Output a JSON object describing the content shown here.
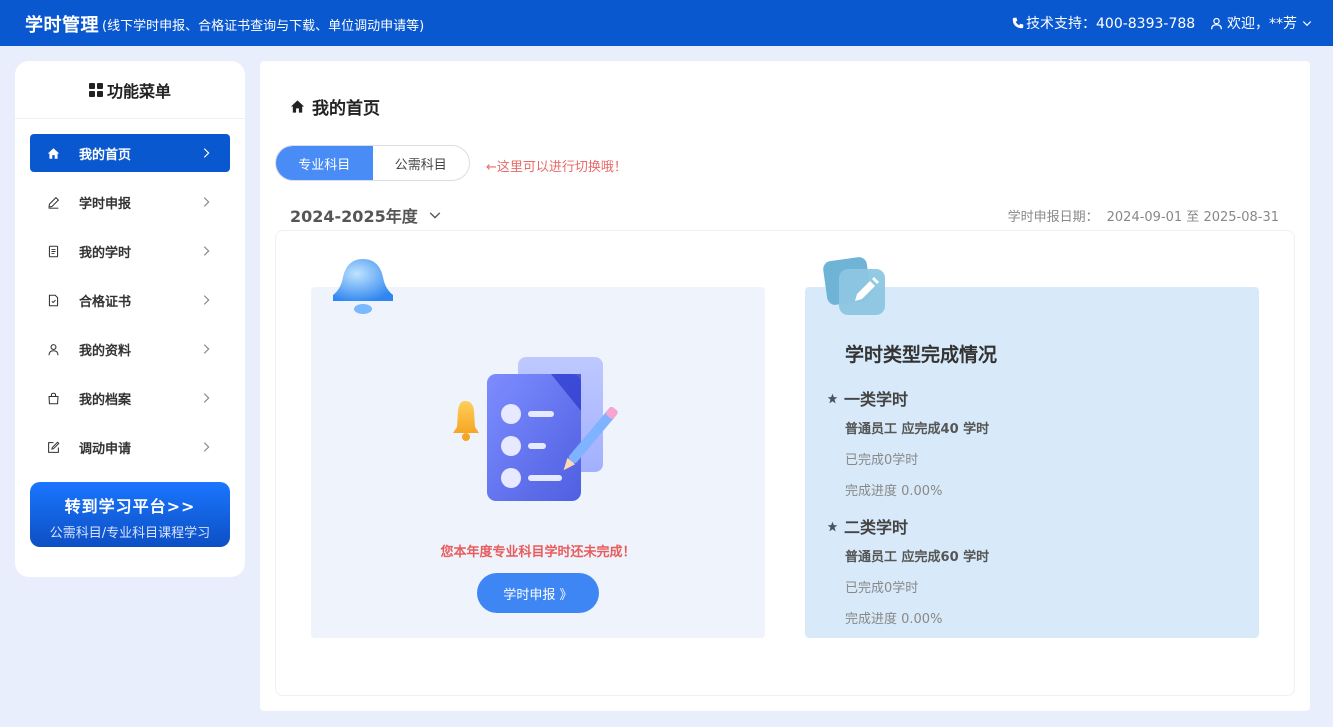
{
  "header": {
    "brand": "学时管理",
    "subtitle": "(线下学时申报、合格证书查询与下载、单位调动申请等)",
    "support_label": "技术支持：400-8393-788",
    "user_label": "欢迎，**芳"
  },
  "sidebar": {
    "title": "功能菜单",
    "items": [
      {
        "label": "我的首页",
        "icon": "home-icon",
        "active": true
      },
      {
        "label": "学时申报",
        "icon": "pen-icon",
        "active": false
      },
      {
        "label": "我的学时",
        "icon": "document-icon",
        "active": false
      },
      {
        "label": "合格证书",
        "icon": "certificate-icon",
        "active": false
      },
      {
        "label": "我的资料",
        "icon": "user-icon",
        "active": false
      },
      {
        "label": "我的档案",
        "icon": "bag-icon",
        "active": false
      },
      {
        "label": "调动申请",
        "icon": "edit-icon",
        "active": false
      }
    ],
    "platform_button": {
      "title": "转到学习平台>>",
      "subtitle": "公需科目/专业科目课程学习"
    }
  },
  "main": {
    "page_title": "我的首页",
    "tabs": [
      {
        "label": "专业科目",
        "active": true
      },
      {
        "label": "公需科目",
        "active": false
      }
    ],
    "tab_hint": "←这里可以进行切换哦！",
    "year_select": "2024-2025年度",
    "date_label": "学时申报日期：",
    "date_value": "2024-09-01 至 2025-08-31",
    "left_card": {
      "warning": "您本年度专业科目学时还未完成！",
      "button": "学时申报 》"
    },
    "right_card": {
      "title": "学时类型完成情况",
      "sections": [
        {
          "name": "一类学时",
          "requirement": "普通员工 应完成40 学时",
          "completed": "已完成0学时",
          "progress": "完成进度 0.00%"
        },
        {
          "name": "二类学时",
          "requirement": "普通员工 应完成60 学时",
          "completed": "已完成0学时",
          "progress": "完成进度 0.00%"
        }
      ]
    }
  },
  "colors": {
    "primary": "#0a58d0",
    "accent_button": "#3f86f5",
    "warning": "#e85c5c",
    "page_bg": "#e9eefc"
  }
}
